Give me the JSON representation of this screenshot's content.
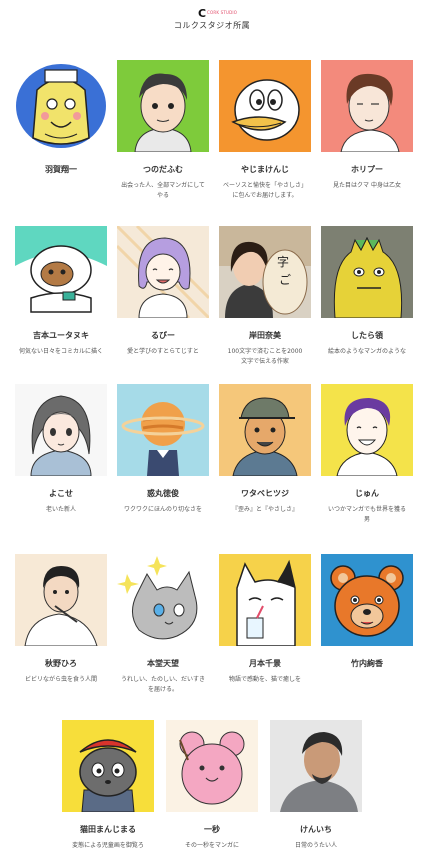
{
  "header": {
    "logo_letter": "C",
    "logo_small": "CORK STUDIO",
    "title": "コルクスタジオ所属"
  },
  "artists": [
    {
      "name": "羽賀翔一",
      "desc": "",
      "icon": "smiling-boy-portrait-icon"
    },
    {
      "name": "つのだふむ",
      "desc": "出会った人、全部マンガにして\nやる",
      "icon": "young-man-portrait-icon"
    },
    {
      "name": "やじまけんじ",
      "desc": "ベーソスと愉快を「やさしさ」\nに包んでお届けします。",
      "icon": "duck-character-icon"
    },
    {
      "name": "ホリプー",
      "desc": "見た目はクマ 中身は乙女",
      "icon": "man-profile-icon"
    },
    {
      "name": "吉本ユータヌキ",
      "desc": "何気ない日々をコミカルに描く",
      "icon": "tanuki-with-phone-icon"
    },
    {
      "name": "るびー",
      "desc": "愛と学びのすとらてじすと",
      "icon": "purple-hair-girl-icon"
    },
    {
      "name": "岸田奈美",
      "desc": "100文字で済むことを2000\n文字で伝える作家",
      "icon": "woman-photo-icon"
    },
    {
      "name": "したら領",
      "desc": "絵本のようなマンガのような",
      "icon": "green-monster-icon"
    },
    {
      "name": "よこせ",
      "desc": "老いた新人",
      "icon": "girl-portrait-icon"
    },
    {
      "name": "惑丸徳俊",
      "desc": "ワクワクにほんのり切なさを",
      "icon": "saturn-head-icon"
    },
    {
      "name": "ワタベヒツジ",
      "desc": "『歪み』と『やさしさ』",
      "icon": "man-with-cap-icon"
    },
    {
      "name": "じゅん",
      "desc": "いつかマンガでも世界を獲る\n男",
      "icon": "smiling-man-icon"
    },
    {
      "name": "秋野ひろ",
      "desc": "ビビリながら虫を食う人間",
      "icon": "boy-eating-icon"
    },
    {
      "name": "本堂天望",
      "desc": "うれしい、たのしい、だいすき\nを届ける。",
      "icon": "gray-cat-icon"
    },
    {
      "name": "月本千景",
      "desc": "物語で感動を、猫で癒しを",
      "icon": "white-cat-drinking-icon"
    },
    {
      "name": "竹内絢香",
      "desc": "",
      "icon": "bear-face-icon"
    },
    {
      "name": "猫田まんじまる",
      "desc": "変態による児童画を御覧ろ",
      "icon": "cat-red-beret-icon"
    },
    {
      "name": "一秒",
      "desc": "その一秒をマンガに",
      "icon": "pink-mouse-icon"
    },
    {
      "name": "けんいち",
      "desc": "日常のうたい人",
      "icon": "man-photo-icon"
    }
  ]
}
